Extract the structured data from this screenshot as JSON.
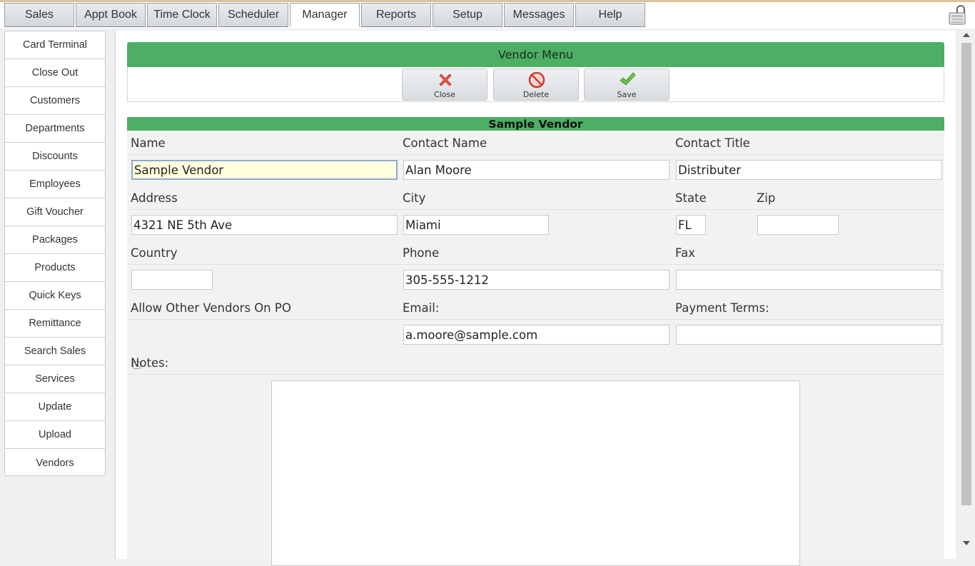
{
  "tabs": [
    {
      "label": "Sales"
    },
    {
      "label": "Appt Book"
    },
    {
      "label": "Time Clock"
    },
    {
      "label": "Scheduler"
    },
    {
      "label": "Manager",
      "active": true
    },
    {
      "label": "Reports"
    },
    {
      "label": "Setup"
    },
    {
      "label": "Messages"
    },
    {
      "label": "Help"
    }
  ],
  "sidebar": {
    "items": [
      {
        "label": "Card Terminal"
      },
      {
        "label": "Close Out"
      },
      {
        "label": "Customers"
      },
      {
        "label": "Departments"
      },
      {
        "label": "Discounts"
      },
      {
        "label": "Employees"
      },
      {
        "label": "Gift Voucher"
      },
      {
        "label": "Packages"
      },
      {
        "label": "Products"
      },
      {
        "label": "Quick Keys"
      },
      {
        "label": "Remittance"
      },
      {
        "label": "Search Sales"
      },
      {
        "label": "Services"
      },
      {
        "label": "Update"
      },
      {
        "label": "Upload"
      },
      {
        "label": "Vendors"
      }
    ]
  },
  "menu": {
    "title": "Vendor Menu",
    "close_label": "Close",
    "delete_label": "Delete",
    "save_label": "Save"
  },
  "form": {
    "title": "Sample Vendor",
    "labels": {
      "name": "Name",
      "contact_name": "Contact Name",
      "contact_title": "Contact Title",
      "address": "Address",
      "city": "City",
      "state": "State",
      "zip": "Zip",
      "country": "Country",
      "phone": "Phone",
      "fax": "Fax",
      "allow_other": "Allow Other Vendors On PO",
      "email": "Email:",
      "payment_terms": "Payment Terms:",
      "notes": "Notes:"
    },
    "values": {
      "name": "Sample Vendor",
      "contact_name": "Alan Moore",
      "contact_title": "Distributer",
      "address": "4321 NE 5th Ave",
      "city": "Miami",
      "state": "FL",
      "zip": "",
      "country": "",
      "phone": "305-555-1212",
      "fax": "",
      "email": "a.moore@sample.com",
      "payment_terms": "",
      "notes": ""
    },
    "allow_other_checked": false
  },
  "colors": {
    "header_green": "#4caf64",
    "focused_field": "#ffffdd"
  }
}
